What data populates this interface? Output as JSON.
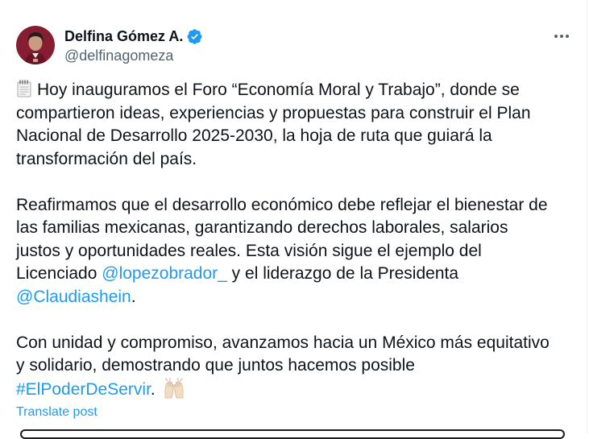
{
  "author": {
    "display_name": "Delfina Gómez A.",
    "handle": "@delfinagomeza",
    "verified": true,
    "avatar_icon": "profile-photo",
    "verified_icon": "verified-badge-icon"
  },
  "post": {
    "paragraph1": {
      "icon": "spiral-notepad-icon",
      "text": "Hoy inauguramos el Foro “Economía Moral y Trabajo”, donde se compartieron ideas, experiencias y propuestas para construir el Plan Nacional de Desarrollo 2025-2030, la hoja de ruta que guiará la transformación del país.",
      "lines": [
        "Hoy inauguramos el Foro “Economía Moral y Trabajo”, donde se",
        "compartieron ideas, experiencias y propuestas para construir el Plan",
        "Nacional de Desarrollo 2025-2030, la hoja de ruta que guiará la",
        "transformación del país."
      ]
    },
    "paragraph2": {
      "line1": "Reafirmamos que el desarrollo económico debe reflejar el bienestar de",
      "line2": "las familias mexicanas, garantizando derechos laborales, salarios",
      "line3": "justos y oportunidades reales. Esta visión sigue el ejemplo del",
      "line4_prefix": "Licenciado ",
      "mention1": "@lopezobrador_",
      "line4_suffix": " y el liderazgo de la Presidenta",
      "mention2": "@Claudiashein",
      "line5_suffix": "."
    },
    "paragraph3": {
      "line1": "Con unidad y compromiso, avanzamos hacia un México más equitativo",
      "line2": "y solidario, demostrando que juntos hacemos posible",
      "hashtag": "#ElPoderDeServir",
      "after_hashtag": ".",
      "emoji_icon": "raising-hands-icon"
    }
  },
  "actions": {
    "translate_label": "Translate post",
    "more_icon": "more-options-icon"
  },
  "colors": {
    "text": "#0f1419",
    "secondary": "#536471",
    "link": "#1d9bf0",
    "verified": "#1d9bf0"
  }
}
